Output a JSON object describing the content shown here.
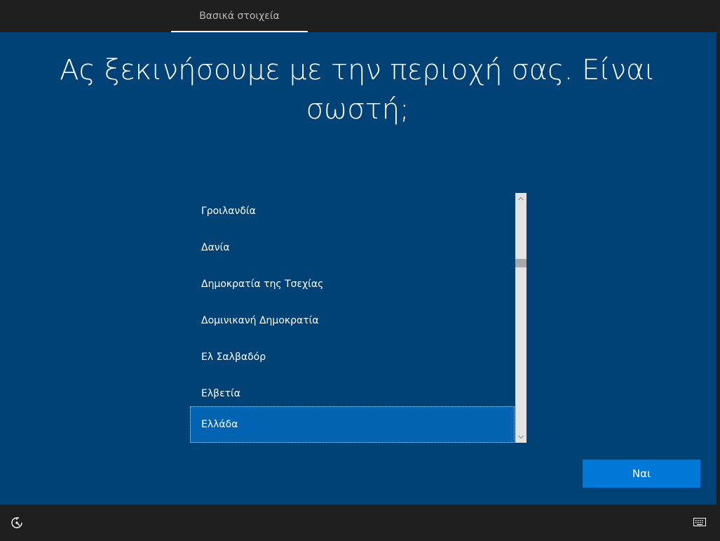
{
  "topbar": {
    "tab_label": "Βασικά στοιχεία"
  },
  "main": {
    "heading": "Ας ξεκινήσουμε με την περιοχή σας. Είναι σωστή;"
  },
  "region_list": {
    "items": [
      {
        "label": "Γροιλανδία",
        "selected": false
      },
      {
        "label": "Δανία",
        "selected": false
      },
      {
        "label": "Δημοκρατία της Τσεχίας",
        "selected": false
      },
      {
        "label": "Δομινικανή Δημοκρατία",
        "selected": false
      },
      {
        "label": "Ελ Σαλβαδόρ",
        "selected": false
      },
      {
        "label": "Ελβετία",
        "selected": false
      },
      {
        "label": "Ελλάδα",
        "selected": true
      }
    ]
  },
  "actions": {
    "yes_label": "Ναι"
  },
  "bottombar": {
    "left_icon": "ease-of-access-icon",
    "right_icon": "keyboard-icon"
  },
  "colors": {
    "background_blue": "#004275",
    "selected_blue": "#0063b1",
    "button_blue": "#0078d7",
    "bar_dark": "#1f1f1f"
  }
}
